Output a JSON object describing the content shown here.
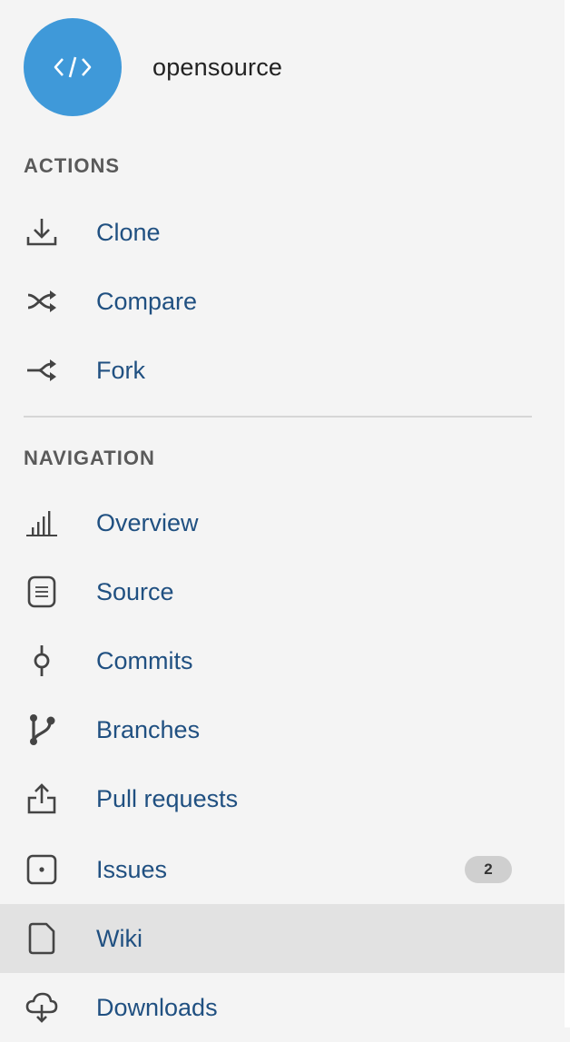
{
  "colors": {
    "avatar_bg": "#3f99d9",
    "avatar_fg": "#ffffff",
    "link": "#205081",
    "icon": "#444444",
    "badge_bg": "#cfcfcf"
  },
  "repo": {
    "avatar_icon": "code-brackets-icon",
    "name": "opensource"
  },
  "actions": {
    "heading": "ACTIONS",
    "items": [
      {
        "label": "Clone",
        "icon": "download-icon"
      },
      {
        "label": "Compare",
        "icon": "shuffle-icon"
      },
      {
        "label": "Fork",
        "icon": "fork-icon"
      }
    ]
  },
  "navigation": {
    "heading": "NAVIGATION",
    "items": [
      {
        "label": "Overview",
        "icon": "bar-chart-icon"
      },
      {
        "label": "Source",
        "icon": "document-icon"
      },
      {
        "label": "Commits",
        "icon": "commit-icon"
      },
      {
        "label": "Branches",
        "icon": "branch-icon"
      },
      {
        "label": "Pull requests",
        "icon": "upload-icon"
      },
      {
        "label": "Issues",
        "icon": "issue-icon",
        "badge": "2"
      },
      {
        "label": "Wiki",
        "icon": "page-icon",
        "active": true
      },
      {
        "label": "Downloads",
        "icon": "cloud-download-icon"
      }
    ]
  }
}
